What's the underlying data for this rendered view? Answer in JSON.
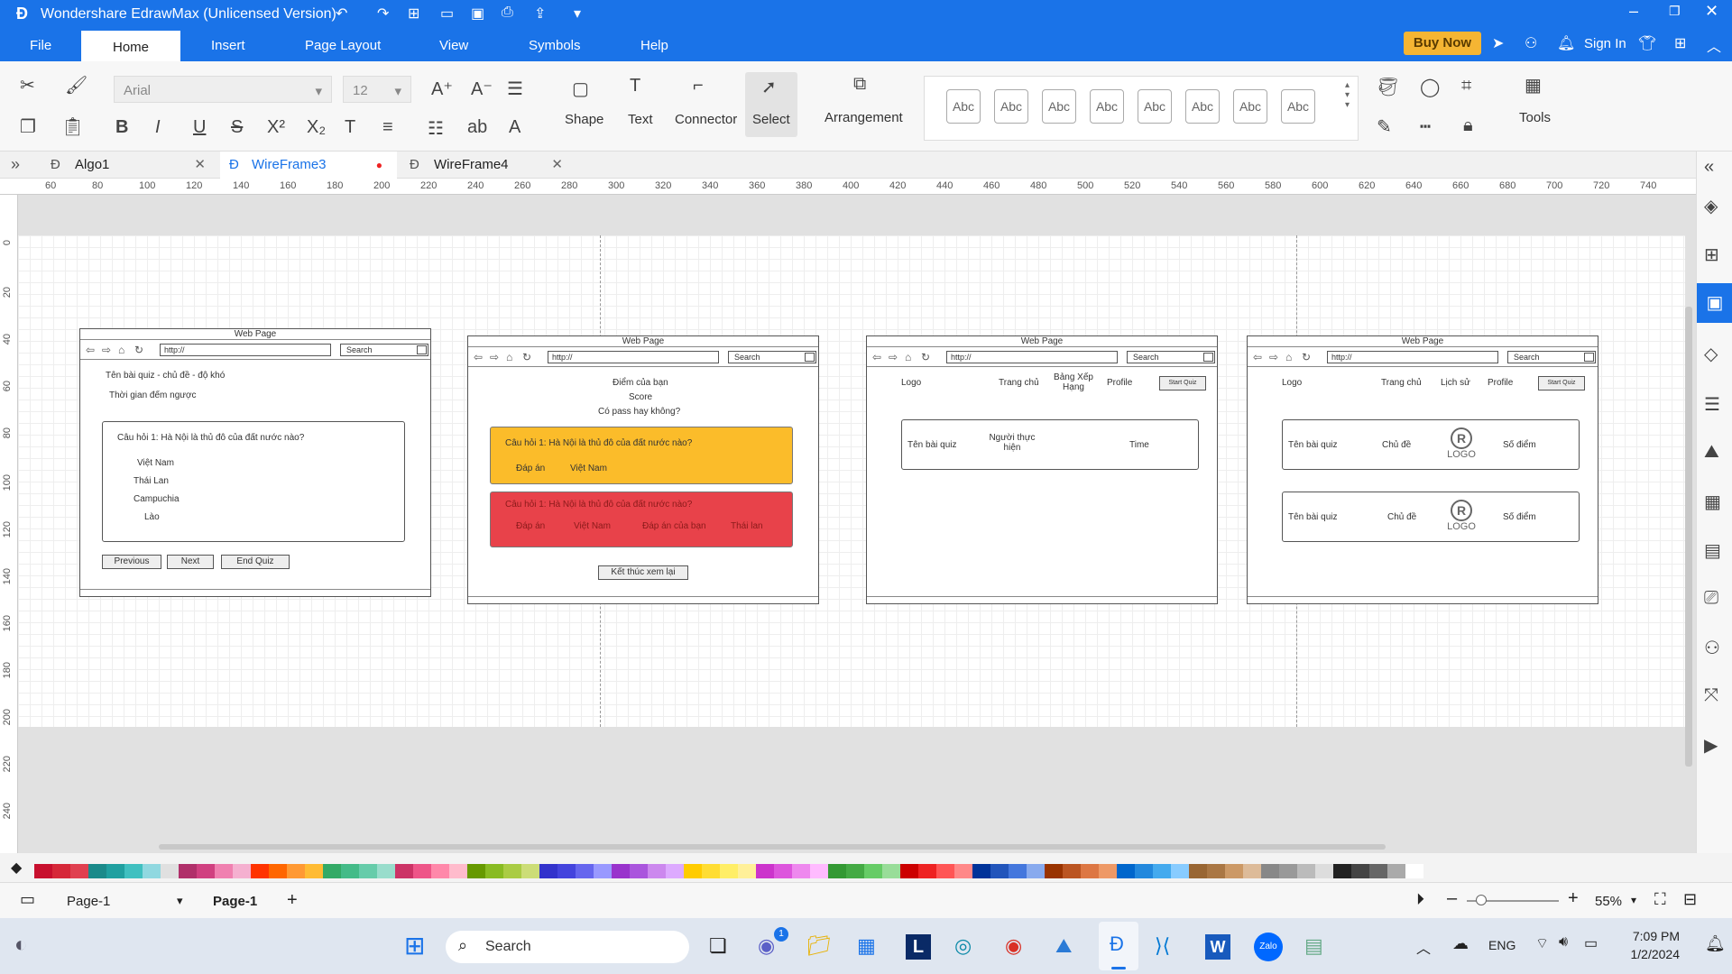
{
  "titlebar": {
    "title": "Wondershare EdrawMax (Unlicensed Version)",
    "buy": "Buy Now",
    "signin": "Sign In"
  },
  "menu": [
    "File",
    "Home",
    "Insert",
    "Page Layout",
    "View",
    "Symbols",
    "Help"
  ],
  "ribbon": {
    "font": "Arial",
    "size": "12",
    "shape": "Shape",
    "text": "Text",
    "connector": "Connector",
    "select": "Select",
    "arrangement": "Arrangement",
    "tools": "Tools",
    "abc": "Abc"
  },
  "tabs": [
    {
      "label": "Algo1"
    },
    {
      "label": "WireFrame3"
    },
    {
      "label": "WireFrame4"
    }
  ],
  "ruler_h": [
    "60",
    "80",
    "100",
    "120",
    "140",
    "160",
    "180",
    "200",
    "220",
    "240",
    "260",
    "280",
    "300",
    "320",
    "340",
    "360",
    "380",
    "400",
    "420",
    "440",
    "460",
    "480",
    "500",
    "520",
    "540",
    "560",
    "580",
    "600",
    "620",
    "640",
    "660",
    "680",
    "700",
    "720",
    "740"
  ],
  "ruler_v": [
    "0",
    "20",
    "40",
    "60",
    "80",
    "100",
    "120",
    "140",
    "160",
    "180",
    "200",
    "220",
    "240"
  ],
  "common": {
    "webpage": "Web Page",
    "url": "http://",
    "search": "Search"
  },
  "wf1": {
    "title": "Tên bài quiz - chủ đề - độ khó",
    "timer": "Thời gian đếm ngược",
    "question": "Câu hỏi 1: Hà Nội là thủ đô của đất nước nào?",
    "options": [
      "Việt Nam",
      "Thái Lan",
      "Campuchia",
      "Lào"
    ],
    "prev": "Previous",
    "next": "Next",
    "end": "End Quiz"
  },
  "wf2": {
    "score_title": "Điểm của bạn",
    "score": "Score",
    "pass": "Có pass hay không?",
    "q1": "Câu hỏi 1: Hà Nội là thủ đô của đất nước nào?",
    "answer_label": "Đáp án",
    "answer": "Việt Nam",
    "q2": "Câu hỏi 1: Hà Nội là thủ đô của đất nước nào?",
    "your_answer_label": "Đáp án của bạn",
    "your_answer": "Thái lan",
    "finish": "Kết thúc xem lại",
    "yellow": "#fbbc2a",
    "red": "#e8424a"
  },
  "wf3": {
    "logo": "Logo",
    "home": "Trang chủ",
    "rank": "Bảng Xếp Hạng",
    "profile": "Profile",
    "start": "Start Quiz",
    "quiz": "Tên bài quiz",
    "doer": "Người thực hiện",
    "time": "Time"
  },
  "wf4": {
    "logo": "Logo",
    "home": "Trang chủ",
    "history": "Lịch sử",
    "profile": "Profile",
    "start": "Start Quiz",
    "quiz": "Tên bài quiz",
    "topic": "Chủ đề",
    "logo_text": "LOGO",
    "score": "Số điểm"
  },
  "status": {
    "page_select": "Page-1",
    "page_tab": "Page-1",
    "zoom": "55%"
  },
  "taskbar": {
    "search": "Search",
    "lang": "ENG",
    "time": "7:09 PM",
    "date": "1/2/2024",
    "badge": "1",
    "zalo": "Zalo"
  },
  "colors": {
    "accent": "#1a73e8",
    "buy": "#f5b533"
  }
}
